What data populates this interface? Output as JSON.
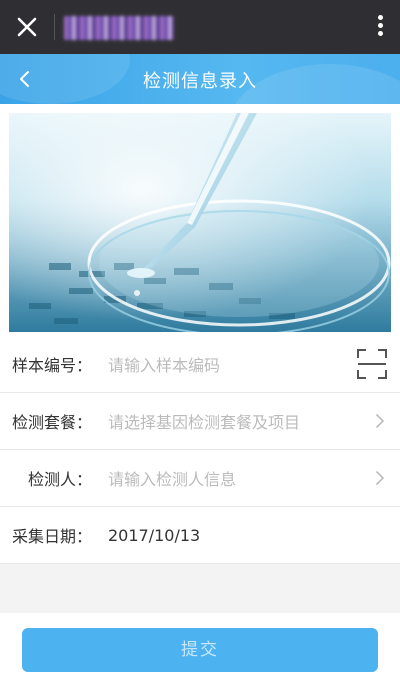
{
  "topbar": {
    "title": "",
    "close_icon": "close-icon",
    "more_icon": "more-vertical-icon"
  },
  "navbar": {
    "title": "检测信息录入",
    "back_icon": "chevron-left-icon",
    "color": "#4aaeee"
  },
  "banner": {
    "image": "pipette-over-petri-dish-photo"
  },
  "form": {
    "sample_id": {
      "label": "样本编号：",
      "placeholder": "请输入样本编码",
      "icon": "scan-qr-icon"
    },
    "package": {
      "label": "检测套餐：",
      "placeholder": "请选择基因检测套餐及项目",
      "icon": "chevron-right-icon"
    },
    "person": {
      "label": "检测人：",
      "placeholder": "请输入检测人信息",
      "icon": "chevron-right-icon"
    },
    "date": {
      "label": "采集日期：",
      "value": "2017/10/13"
    }
  },
  "footer": {
    "submit_label": "提交",
    "submit_color": "#4cb3f0"
  }
}
